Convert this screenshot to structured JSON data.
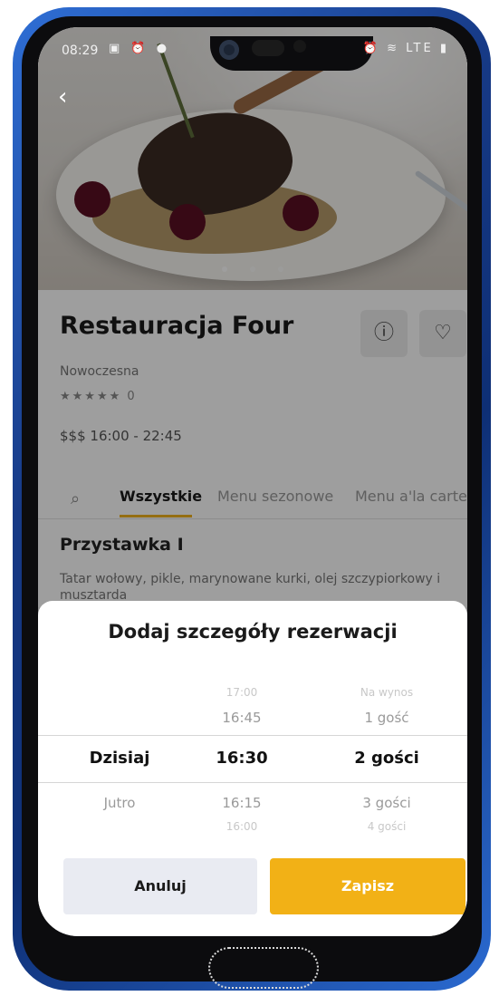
{
  "status_bar": {
    "time": "08:29",
    "left_icons": "▣ ⏰ ●",
    "right_icons": "⏰ ≋ LTE ▮"
  },
  "restaurant": {
    "name": "Restauracja Four",
    "cuisine": "Nowoczesna",
    "rating_text": "★★★★★  0",
    "price_hours": "$$$  16:00 - 22:45"
  },
  "tabs": {
    "items": [
      {
        "label": "Wszystkie",
        "active": true
      },
      {
        "label": "Menu sezonowe",
        "active": false
      },
      {
        "label": "Menu a'la carte",
        "active": false
      }
    ]
  },
  "menu_item": {
    "title": "Przystawka I",
    "description": "Tatar wołowy, pikle, marynowane kurki, olej szczypiorkowy i musztarda"
  },
  "sheet": {
    "title": "Dodaj szczegóły rezerwacji",
    "day": {
      "selected": "Dzisiaj",
      "after": [
        "Jutro"
      ]
    },
    "time": {
      "before": [
        "17:00",
        "16:45"
      ],
      "selected": "16:30",
      "after": [
        "16:15",
        "16:00"
      ]
    },
    "guests": {
      "before": [
        "Na wynos",
        "1 gość"
      ],
      "selected": "2 gości",
      "after": [
        "3 gości",
        "4 gości"
      ]
    },
    "cancel_label": "Anuluj",
    "save_label": "Zapisz"
  },
  "colors": {
    "accent": "#f2b116",
    "cancel_bg": "#e9ebf2"
  }
}
